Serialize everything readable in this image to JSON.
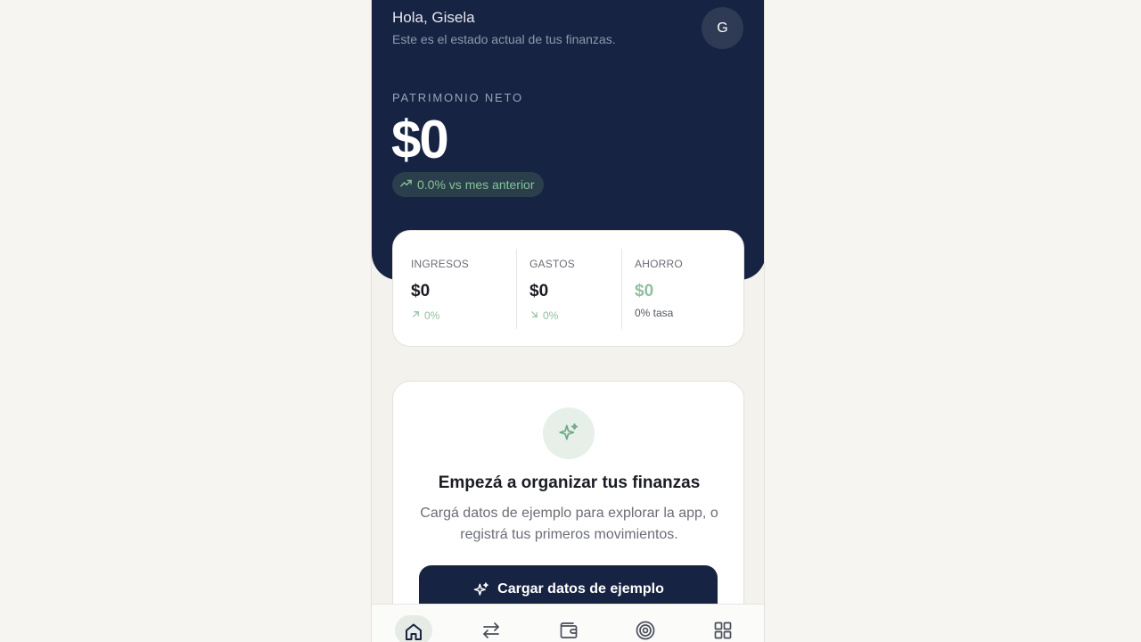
{
  "header": {
    "greeting": "Hola, Gisela",
    "subtitle": "Este es el estado actual de tus finanzas.",
    "avatar_initial": "G"
  },
  "net_worth": {
    "label": "PATRIMONIO NETO",
    "value": "$0",
    "change": "0.0% vs mes anterior",
    "change_icon": "trending-up-icon"
  },
  "stats": {
    "ingresos": {
      "label": "INGRESOS",
      "value": "$0",
      "change": "0%",
      "change_icon": "arrow-up-right-icon"
    },
    "gastos": {
      "label": "GASTOS",
      "value": "$0",
      "change": "0%",
      "change_icon": "arrow-down-right-icon"
    },
    "ahorro": {
      "label": "AHORRO",
      "value": "$0",
      "rate": "0% tasa"
    }
  },
  "empty_state": {
    "icon": "sparkles-icon",
    "title": "Empezá a organizar tus finanzas",
    "description": "Cargá datos de ejemplo para explorar la app, o registrá tus primeros movimientos.",
    "button_label": "Cargar datos de ejemplo"
  },
  "nav": {
    "items": [
      "home-icon",
      "transfers-icon",
      "wallet-icon",
      "target-icon",
      "grid-icon"
    ],
    "active": "home-icon"
  },
  "colors": {
    "navy": "#172342",
    "accent_green": "#8fbf9f",
    "background": "#f3f2ed"
  }
}
